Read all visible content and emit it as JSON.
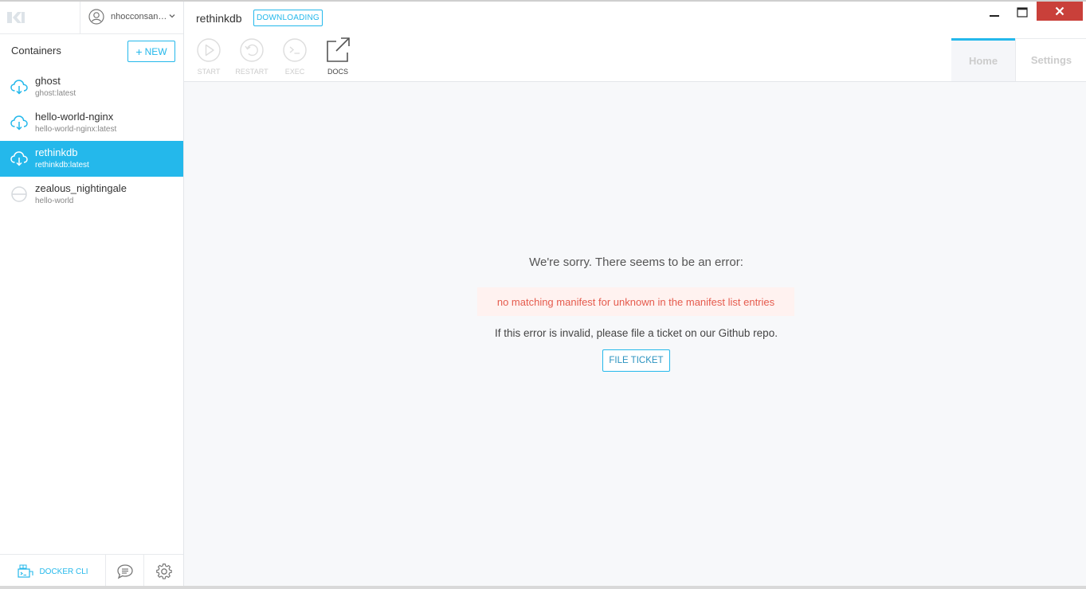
{
  "app": {
    "logo": "kitematic-logo",
    "user": {
      "name": "nhocconsanh...",
      "avatar_icon": "user-circle-icon",
      "menu_icon": "chevron-down-icon"
    }
  },
  "sidebar": {
    "title": "Containers",
    "new_button": {
      "label": "NEW",
      "icon": "plus-icon"
    },
    "containers": [
      {
        "name": "ghost",
        "image": "ghost:latest",
        "icon": "cloud-download-icon",
        "active": false
      },
      {
        "name": "hello-world-nginx",
        "image": "hello-world-nginx:latest",
        "icon": "cloud-download-icon",
        "active": false
      },
      {
        "name": "rethinkdb",
        "image": "rethinkdb:latest",
        "icon": "cloud-download-icon",
        "active": true
      },
      {
        "name": "zealous_nightingale",
        "image": "hello-world",
        "icon": "stopped-icon",
        "active": false
      }
    ],
    "footer": {
      "docker_cli_label": "DOCKER CLI",
      "docker_cli_icon": "docker-whale-icon",
      "feedback_icon": "chat-bubble-icon",
      "settings_icon": "gear-icon"
    }
  },
  "header": {
    "container_name": "rethinkdb",
    "status_badge": "DOWNLOADING",
    "toolbar": [
      {
        "label": "START",
        "icon": "play-icon",
        "enabled": false
      },
      {
        "label": "RESTART",
        "icon": "restart-icon",
        "enabled": false
      },
      {
        "label": "EXEC",
        "icon": "terminal-icon",
        "enabled": false
      },
      {
        "label": "DOCS",
        "icon": "external-link-icon",
        "enabled": true
      }
    ],
    "tabs": [
      {
        "label": "Home",
        "active": true
      },
      {
        "label": "Settings",
        "active": false
      }
    ],
    "window_controls": [
      "minimize-icon",
      "maximize-icon",
      "close-icon"
    ]
  },
  "error": {
    "title": "We're sorry. There seems to be an error:",
    "message": "no matching manifest for unknown in the manifest list entries",
    "subtitle": "If this error is invalid, please file a ticket on our Github repo.",
    "button": "FILE TICKET"
  },
  "colors": {
    "accent": "#24b8eb",
    "error_text": "#e55b4d",
    "error_bg": "#fff2f0",
    "close_button": "#c9403a"
  }
}
